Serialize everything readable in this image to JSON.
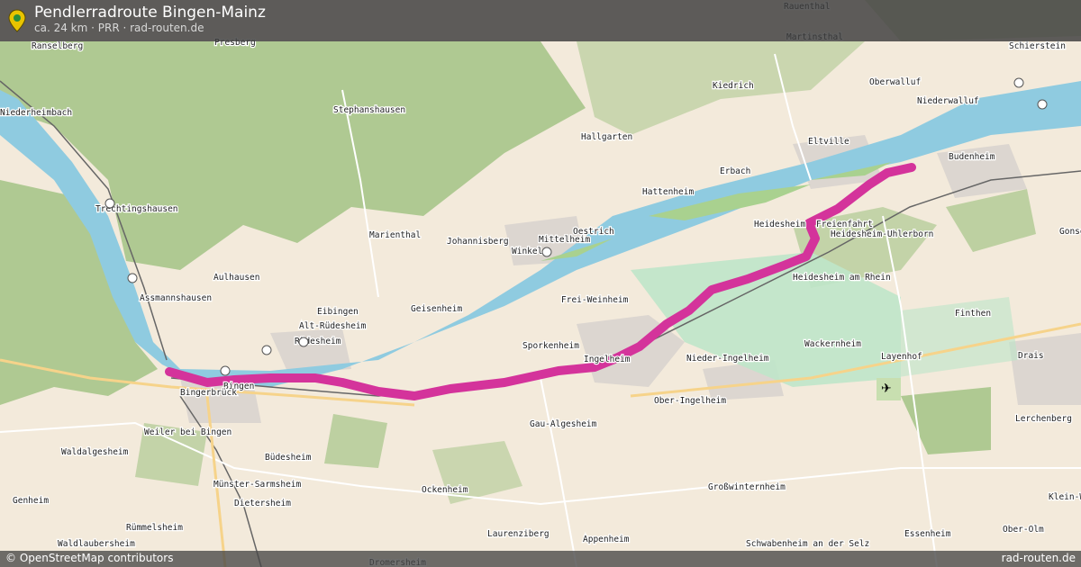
{
  "header": {
    "title": "Pendlerradroute Bingen-Mainz",
    "subtitle": "ca. 24 km · PRR · rad-routen.de"
  },
  "footer": {
    "attribution": "© OpenStreetMap contributors",
    "brand": "rad-routen.de"
  },
  "map": {
    "route_color": "#d4339b",
    "water_color": "#8fcbe0",
    "forest_color": "#a9c98e",
    "icons": [
      "location-pin-icon",
      "train-station-icon",
      "airport-icon"
    ],
    "places": [
      {
        "id": "rauenthal",
        "name": "Rauenthal"
      },
      {
        "id": "martinsthal",
        "name": "Martinsthal"
      },
      {
        "id": "ranselberg",
        "name": "Ranselberg"
      },
      {
        "id": "presberg",
        "name": "Presberg"
      },
      {
        "id": "schierstein",
        "name": "Schierstein"
      },
      {
        "id": "oberwalluf",
        "name": "Oberwalluf"
      },
      {
        "id": "niederwalluf",
        "name": "Niederwalluf"
      },
      {
        "id": "kiedrich",
        "name": "Kiedrich"
      },
      {
        "id": "niederheimbach",
        "name": "Niederheimbach"
      },
      {
        "id": "stephanshausen",
        "name": "Stephanshausen"
      },
      {
        "id": "hallgarten",
        "name": "Hallgarten"
      },
      {
        "id": "eltville",
        "name": "Eltville"
      },
      {
        "id": "erbach",
        "name": "Erbach"
      },
      {
        "id": "budenheim",
        "name": "Budenheim"
      },
      {
        "id": "hattenheim",
        "name": "Hattenheim"
      },
      {
        "id": "trechtingshausen",
        "name": "Trechtingshausen"
      },
      {
        "id": "heidesheim",
        "name": "Heidesheim"
      },
      {
        "id": "freienfahrt",
        "name": "Freienfahrt"
      },
      {
        "id": "oestrich",
        "name": "Oestrich"
      },
      {
        "id": "marienthal",
        "name": "Marienthal"
      },
      {
        "id": "johannisberg",
        "name": "Johannisberg"
      },
      {
        "id": "mittelheim",
        "name": "Mittelheim"
      },
      {
        "id": "winkel",
        "name": "Winkel"
      },
      {
        "id": "heidesheim-uhlerborn",
        "name": "Heidesheim-Uhlerborn"
      },
      {
        "id": "gonsenheim",
        "name": "Gonse"
      },
      {
        "id": "aulhausen",
        "name": "Aulhausen"
      },
      {
        "id": "heidesheim-am-rhein",
        "name": "Heidesheim am Rhein"
      },
      {
        "id": "assmannshausen",
        "name": "Assmannshausen"
      },
      {
        "id": "frei-weinheim",
        "name": "Frei-Weinheim"
      },
      {
        "id": "eibingen",
        "name": "Eibingen"
      },
      {
        "id": "geisenheim",
        "name": "Geisenheim"
      },
      {
        "id": "finthen",
        "name": "Finthen"
      },
      {
        "id": "alt-ruedesheim",
        "name": "Alt-Rüdesheim"
      },
      {
        "id": "ruedesheim",
        "name": "Rüdesheim"
      },
      {
        "id": "sporkenheim",
        "name": "Sporkenheim"
      },
      {
        "id": "wackernheim",
        "name": "Wackernheim"
      },
      {
        "id": "ingelheim",
        "name": "Ingelheim"
      },
      {
        "id": "nieder-ingelheim",
        "name": "Nieder-Ingelheim"
      },
      {
        "id": "layenhof",
        "name": "Layenhof"
      },
      {
        "id": "drais",
        "name": "Drais"
      },
      {
        "id": "bingen",
        "name": "Bingen"
      },
      {
        "id": "bingerbrueck",
        "name": "Bingerbrück"
      },
      {
        "id": "ober-ingelheim",
        "name": "Ober-Ingelheim"
      },
      {
        "id": "gau-algesheim",
        "name": "Gau-Algesheim"
      },
      {
        "id": "lerchenberg",
        "name": "Lerchenberg"
      },
      {
        "id": "weiler-bei-bingen",
        "name": "Weiler bei Bingen"
      },
      {
        "id": "waldalgesheim",
        "name": "Waldalgesheim"
      },
      {
        "id": "buedesheim",
        "name": "Büdesheim"
      },
      {
        "id": "muenster-sarmsheim",
        "name": "Münster-Sarmsheim"
      },
      {
        "id": "grosswinternheim",
        "name": "Großwinternheim"
      },
      {
        "id": "genheim",
        "name": "Genheim"
      },
      {
        "id": "dietersheim",
        "name": "Dietersheim"
      },
      {
        "id": "ockenheim",
        "name": "Ockenheim"
      },
      {
        "id": "klein-winternheim",
        "name": "Klein-W"
      },
      {
        "id": "ruemmelsheim",
        "name": "Rümmelsheim"
      },
      {
        "id": "ober-olm",
        "name": "Ober-Olm"
      },
      {
        "id": "laurenziberg",
        "name": "Laurenziberg"
      },
      {
        "id": "appenheim",
        "name": "Appenheim"
      },
      {
        "id": "essenheim",
        "name": "Essenheim"
      },
      {
        "id": "waldlaubersheim",
        "name": "Waldlaubersheim"
      },
      {
        "id": "schwabenheim",
        "name": "Schwabenheim an der Selz"
      },
      {
        "id": "dromersheim",
        "name": "Dromersheim"
      }
    ]
  }
}
